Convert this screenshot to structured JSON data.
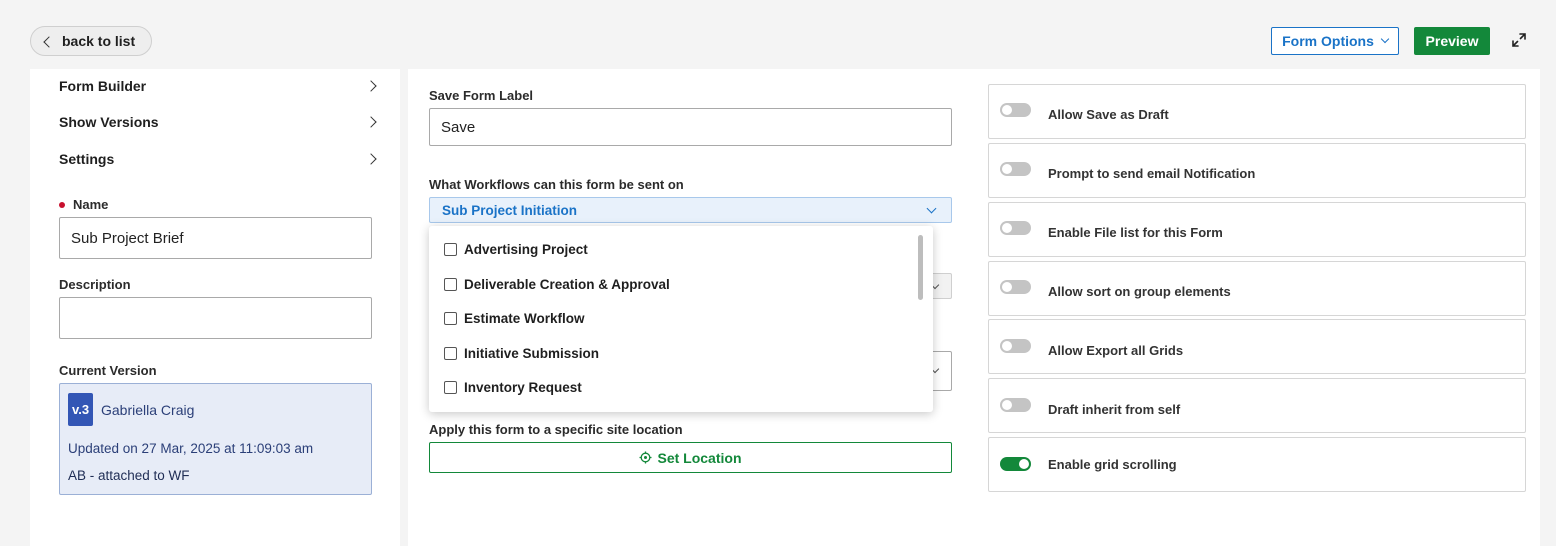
{
  "topbar": {
    "back_label": "back to list",
    "form_options_label": "Form Options",
    "preview_label": "Preview"
  },
  "sidebar": {
    "nav": [
      {
        "label": "Form Builder"
      },
      {
        "label": "Show Versions"
      },
      {
        "label": "Settings"
      }
    ],
    "name_label": "Name",
    "name_value": "Sub Project Brief",
    "description_label": "Description",
    "description_value": "",
    "current_version_label": "Current Version",
    "version": {
      "badge": "v.3",
      "user": "Gabriella Craig",
      "updated": "Updated on 27 Mar, 2025 at 11:09:03 am",
      "note": "AB - attached to WF"
    }
  },
  "settings": {
    "save_label_title": "Save Form Label",
    "save_label_value": "Save",
    "workflows_title": "What Workflows can this form be sent on",
    "workflows_selected": "Sub Project Initiation",
    "workflow_options": [
      {
        "label": "Advertising Project",
        "checked": false
      },
      {
        "label": "Deliverable Creation & Approval",
        "checked": false
      },
      {
        "label": "Estimate Workflow",
        "checked": false
      },
      {
        "label": "Initiative Submission",
        "checked": false
      },
      {
        "label": "Inventory Request",
        "checked": false
      }
    ],
    "location_title": "Apply this form to a specific site location",
    "set_location_label": "Set Location"
  },
  "toggles": [
    {
      "label": "Allow Save as Draft",
      "on": false
    },
    {
      "label": "Prompt to send email Notification",
      "on": false
    },
    {
      "label": "Enable File list for this Form",
      "on": false
    },
    {
      "label": "Allow sort on group elements",
      "on": false
    },
    {
      "label": "Allow Export all Grids",
      "on": false
    },
    {
      "label": "Draft inherit from self",
      "on": false
    },
    {
      "label": "Enable grid scrolling",
      "on": true
    }
  ],
  "colors": {
    "accent_blue": "#1a73c7",
    "accent_green": "#13883a",
    "required_red": "#c8102e",
    "version_badge": "#3356b5"
  }
}
